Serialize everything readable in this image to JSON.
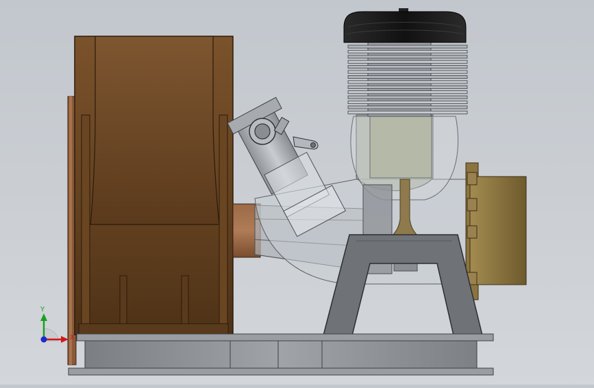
{
  "view": {
    "colors": {
      "background_top": "#c2c7cd",
      "background_bottom": "#d3d6da",
      "housing_wood": "#6e4a26",
      "housing_wood_dark": "#4e3217",
      "cylinder_head": "#1c1c1c",
      "cooling_fins": "#b9bec4",
      "glass_shell": "#c8ccd2",
      "brass_part": "#8c7440",
      "frame_grey": "#6f7276",
      "base_grey": "#8a8e93",
      "copper_pipe": "#8a5a3a"
    }
  },
  "triad": {
    "y_label": "Y",
    "x_label": "X",
    "z_label": "Z"
  }
}
